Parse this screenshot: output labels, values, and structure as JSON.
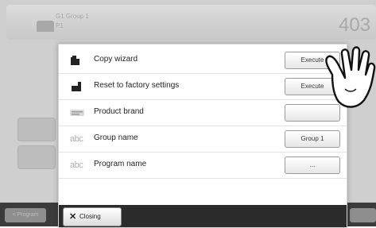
{
  "background": {
    "header_line1": "G1  Group 1",
    "header_line2": "P1",
    "big_number": "403",
    "left_btn_1": "",
    "left_btn_2": "",
    "bottom_left_label": "< Program",
    "bottom_right_label": ""
  },
  "dialog": {
    "rows": [
      {
        "label": "Copy wizard",
        "button": "Execute",
        "icon": "copy-icon"
      },
      {
        "label": "Reset to factory settings",
        "button": "Execute",
        "icon": "reset-icon"
      },
      {
        "label": "Product brand",
        "button": "",
        "icon": "brand-logo-icon"
      },
      {
        "label": "Group name",
        "button": "Group 1",
        "icon": "abc-icon"
      },
      {
        "label": "Program name",
        "button": "...",
        "icon": "abc-icon"
      }
    ],
    "abc_text": "abc",
    "closing_label": "Closing",
    "closing_x": "✕"
  },
  "colors": {
    "footer": "#2b2b2b",
    "dialog_bg": "#ffffff"
  }
}
